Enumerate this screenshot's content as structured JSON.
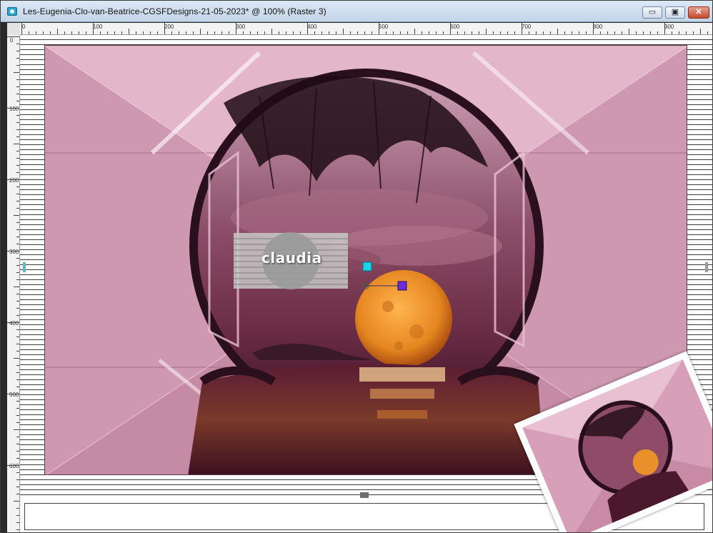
{
  "window": {
    "title": "Les-Eugenia-Clo-van-Beatrice-CGSFDesigns-21-05-2023* @ 100% (Raster 3)",
    "buttons": {
      "minimize": "▭",
      "maximize": "▣",
      "close": "✕"
    }
  },
  "ruler": {
    "top_labels": [
      "0",
      "100",
      "200",
      "300",
      "400",
      "500",
      "600",
      "700",
      "800",
      "900"
    ],
    "left_labels": [
      "0",
      "100",
      "200",
      "300",
      "400",
      "500",
      "600"
    ]
  },
  "canvas": {
    "watermark": "claudia",
    "colors": {
      "pink": "#d9a6bd",
      "dark_frame": "#2a0f1c",
      "moon": "#e8902a",
      "handle_cyan": "#19d3e6",
      "handle_purple": "#6b2bd6"
    }
  }
}
